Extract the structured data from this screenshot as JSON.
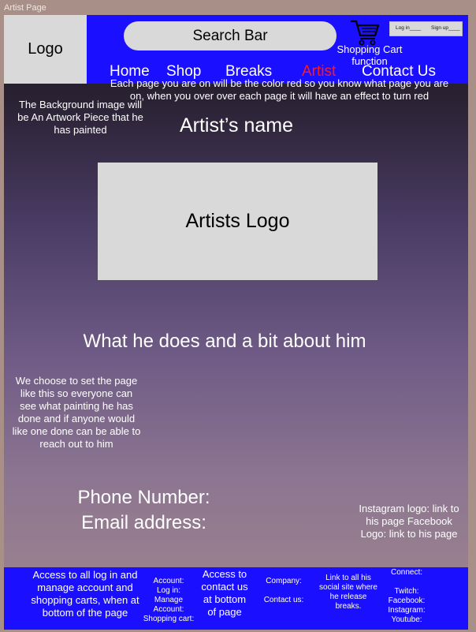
{
  "frame_label": "Artist Page",
  "header": {
    "logo": "Logo",
    "search": "Search Bar",
    "cart_label": "Shopping Cart function",
    "auth": {
      "login": "Log in____",
      "signup": "Sign up____"
    }
  },
  "nav": {
    "items": [
      "Home",
      "Shop",
      "Breaks",
      "Artist",
      "Contact Us"
    ],
    "active": "Artist",
    "note": "Each page you are on will be the color red so you know what page you are on, when you over over each page it will have an effect to turn red"
  },
  "main": {
    "bg_note": "The Background image will be An Artwork Piece that he has painted",
    "artist_name": "Artist’s name",
    "artist_logo": "Artists Logo",
    "about": "What he does and a bit about him",
    "choice_note": "We choose to set the page like this so everyone can see what painting he has done and if anyone would like one done can be able to reach out to him",
    "phone": "Phone Number:",
    "email": "Email address:",
    "social_note": "Instagram logo: link to his page Facebook Logo: link to his page"
  },
  "footer": {
    "col1": "Access to all log in and manage account and shopping carts, when at bottom of the page",
    "col2": "Account:\nLog in:\nManage Account:\nShopping cart:",
    "col3": "Access to contact us at bottom of page",
    "col4": "Company:\n\nContact us:",
    "col5": "Link to all his social site where he release breaks.",
    "col6": "Connect:\n\nTwitch:\nFacebook:\nInstagram:\nYoutube:"
  },
  "colors": {
    "header_bg": "#1a10ff",
    "active_nav": "#ff1a1a",
    "placeholder_box": "#d9d9d9"
  }
}
